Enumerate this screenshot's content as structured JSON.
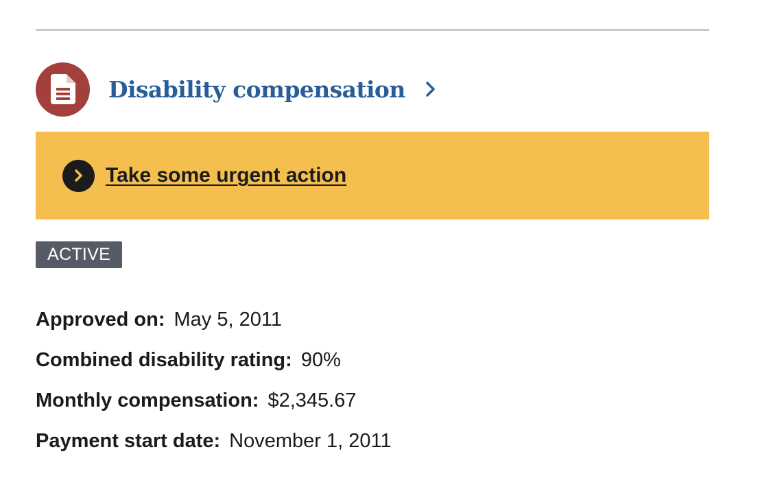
{
  "header": {
    "title": "Disability compensation",
    "icon": "document-icon",
    "chevron_icon": "chevron-right-icon"
  },
  "alert": {
    "icon": "chevron-circle-right-icon",
    "link_text": "Take some urgent action"
  },
  "status_badge": "ACTIVE",
  "details": [
    {
      "label": "Approved on:",
      "value": "May 5, 2011"
    },
    {
      "label": "Combined disability rating:",
      "value": "90%"
    },
    {
      "label": "Monthly compensation:",
      "value": "$2,345.67"
    },
    {
      "label": "Payment start date:",
      "value": "November 1, 2011"
    }
  ],
  "colors": {
    "icon_circle": "#a3403b",
    "title_link": "#275d99",
    "alert_background": "#f4bf4f",
    "badge_background": "#565c65",
    "divider": "#c9c9c9"
  }
}
